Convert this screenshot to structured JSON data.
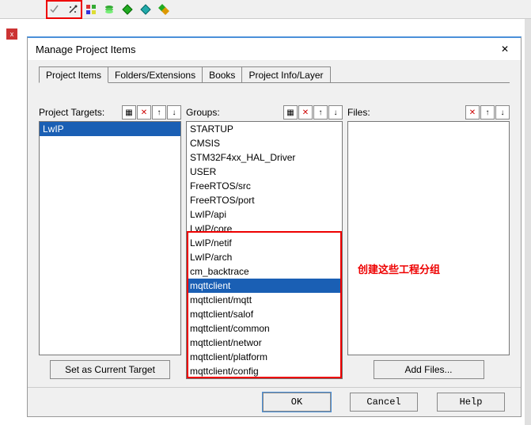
{
  "toolbar": {
    "icons": [
      "check-icon",
      "wand-icon",
      "boxes-icon",
      "stack-icon",
      "diamond-green-icon",
      "diamond-teal-icon",
      "diamond-multi-icon"
    ]
  },
  "dialog": {
    "title": "Manage Project Items",
    "close": "✕"
  },
  "tabs": [
    {
      "label": "Project Items",
      "active": true
    },
    {
      "label": "Folders/Extensions",
      "active": false
    },
    {
      "label": "Books",
      "active": false
    },
    {
      "label": "Project Info/Layer",
      "active": false
    }
  ],
  "targets": {
    "label": "Project Targets:",
    "items": [
      "LwIP"
    ],
    "selected": 0,
    "button": "Set as Current Target"
  },
  "groups": {
    "label": "Groups:",
    "items": [
      "STARTUP",
      "CMSIS",
      "STM32F4xx_HAL_Driver",
      "USER",
      "FreeRTOS/src",
      "FreeRTOS/port",
      "LwIP/api",
      "LwIP/core",
      "LwIP/netif",
      "LwIP/arch",
      "cm_backtrace",
      "mqttclient",
      "mqttclient/mqtt",
      "mqttclient/salof",
      "mqttclient/common",
      "mqttclient/networ",
      "mqttclient/platform",
      "mqttclient/config"
    ],
    "selected": 11
  },
  "files": {
    "label": "Files:",
    "items": [],
    "button": "Add Files..."
  },
  "annotation": {
    "text": "创建这些工程分组"
  },
  "buttons": {
    "ok": "OK",
    "cancel": "Cancel",
    "help": "Help"
  },
  "header_icons": {
    "new": "▦",
    "delete": "✕",
    "up": "↑",
    "down": "↓"
  },
  "close_badge": "x"
}
